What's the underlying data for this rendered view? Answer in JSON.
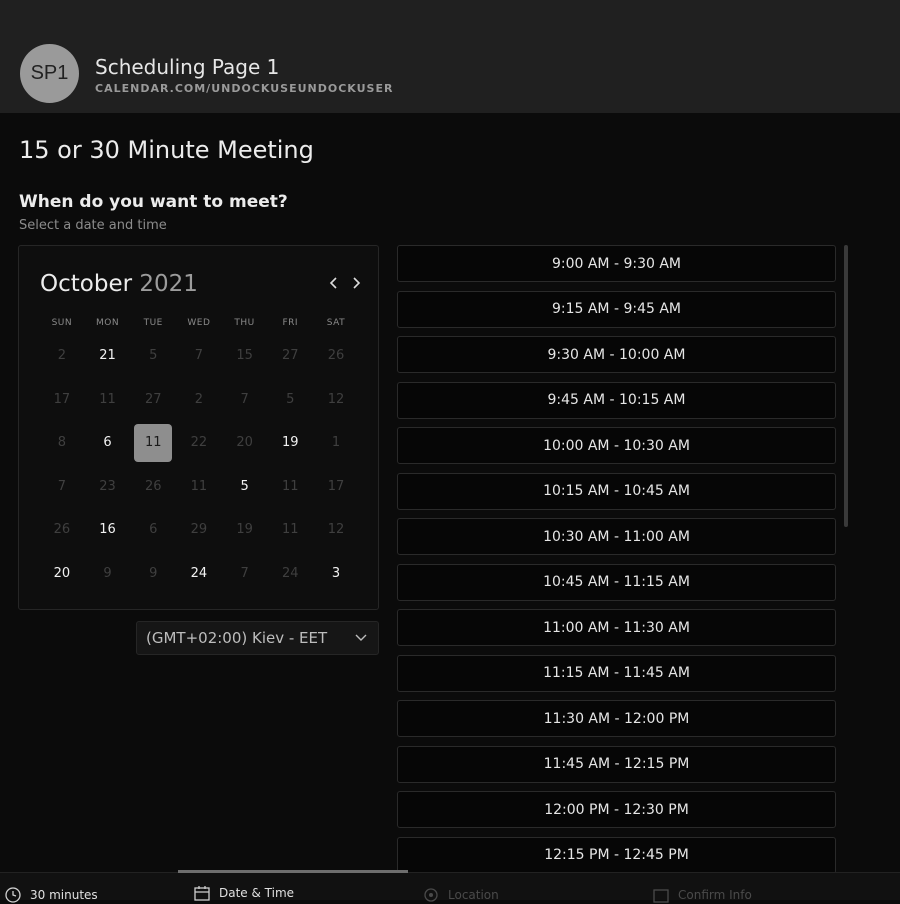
{
  "header": {
    "avatar_initials": "SP1",
    "title": "Scheduling Page 1",
    "url": "CALENDAR.COM/UNDOCKUSEUNDOCKUSER"
  },
  "meeting_title": "15 or 30 Minute Meeting",
  "question": "When do you want to meet?",
  "sub_question": "Select a date and time",
  "calendar": {
    "month": "October",
    "year": "2021",
    "prev_icon": "chevron-left-icon",
    "next_icon": "chevron-right-icon",
    "weekdays": [
      "SUN",
      "MON",
      "TUE",
      "WED",
      "THU",
      "FRI",
      "SAT"
    ],
    "weeks": [
      [
        {
          "d": "2",
          "s": "muted"
        },
        {
          "d": "21",
          "s": "avail"
        },
        {
          "d": "5",
          "s": "muted"
        },
        {
          "d": "7",
          "s": "muted"
        },
        {
          "d": "15",
          "s": "muted"
        },
        {
          "d": "27",
          "s": "muted"
        },
        {
          "d": "26",
          "s": "muted"
        }
      ],
      [
        {
          "d": "17",
          "s": "muted"
        },
        {
          "d": "11",
          "s": "muted"
        },
        {
          "d": "27",
          "s": "muted"
        },
        {
          "d": "2",
          "s": "muted"
        },
        {
          "d": "7",
          "s": "muted"
        },
        {
          "d": "5",
          "s": "muted"
        },
        {
          "d": "12",
          "s": "muted"
        }
      ],
      [
        {
          "d": "8",
          "s": "muted"
        },
        {
          "d": "6",
          "s": "avail"
        },
        {
          "d": "11",
          "s": "selected"
        },
        {
          "d": "22",
          "s": "muted"
        },
        {
          "d": "20",
          "s": "muted"
        },
        {
          "d": "19",
          "s": "avail"
        },
        {
          "d": "1",
          "s": "muted"
        }
      ],
      [
        {
          "d": "7",
          "s": "muted"
        },
        {
          "d": "23",
          "s": "muted"
        },
        {
          "d": "26",
          "s": "muted"
        },
        {
          "d": "11",
          "s": "muted"
        },
        {
          "d": "5",
          "s": "avail"
        },
        {
          "d": "11",
          "s": "muted"
        },
        {
          "d": "17",
          "s": "muted"
        }
      ],
      [
        {
          "d": "26",
          "s": "muted"
        },
        {
          "d": "16",
          "s": "avail"
        },
        {
          "d": "6",
          "s": "muted"
        },
        {
          "d": "29",
          "s": "muted"
        },
        {
          "d": "19",
          "s": "muted"
        },
        {
          "d": "11",
          "s": "muted"
        },
        {
          "d": "12",
          "s": "muted"
        }
      ],
      [
        {
          "d": "20",
          "s": "avail"
        },
        {
          "d": "9",
          "s": "muted"
        },
        {
          "d": "9",
          "s": "muted"
        },
        {
          "d": "24",
          "s": "avail"
        },
        {
          "d": "7",
          "s": "muted"
        },
        {
          "d": "24",
          "s": "muted"
        },
        {
          "d": "3",
          "s": "avail"
        }
      ]
    ]
  },
  "timezone": {
    "selected": "(GMT+02:00) Kiev - EET",
    "icon": "chevron-down-icon"
  },
  "time_slots": [
    "9:00 AM - 9:30 AM",
    "9:15 AM - 9:45 AM",
    "9:30 AM - 10:00 AM",
    "9:45 AM - 10:15 AM",
    "10:00 AM - 10:30 AM",
    "10:15 AM - 10:45 AM",
    "10:30 AM - 11:00 AM",
    "10:45 AM - 11:15 AM",
    "11:00 AM - 11:30 AM",
    "11:15 AM - 11:45 AM",
    "11:30 AM - 12:00 PM",
    "11:45 AM - 12:15 PM",
    "12:00 PM - 12:30 PM",
    "12:15 PM - 12:45 PM"
  ],
  "footer": {
    "steps": [
      {
        "label": "30 minutes",
        "icon": "clock-icon",
        "state": "done"
      },
      {
        "label": "Date & Time",
        "icon": "calendar-icon",
        "state": "active"
      },
      {
        "label": "Location",
        "icon": "location-pin-icon",
        "state": "pending"
      },
      {
        "label": "Confirm Info",
        "icon": "checkbox-icon",
        "state": "pending"
      }
    ]
  },
  "colors": {
    "header_bg": "#202020",
    "page_bg": "#0b0b0b",
    "selected_day_bg": "#8e8e8e",
    "muted_text": "#3f3f3f"
  }
}
